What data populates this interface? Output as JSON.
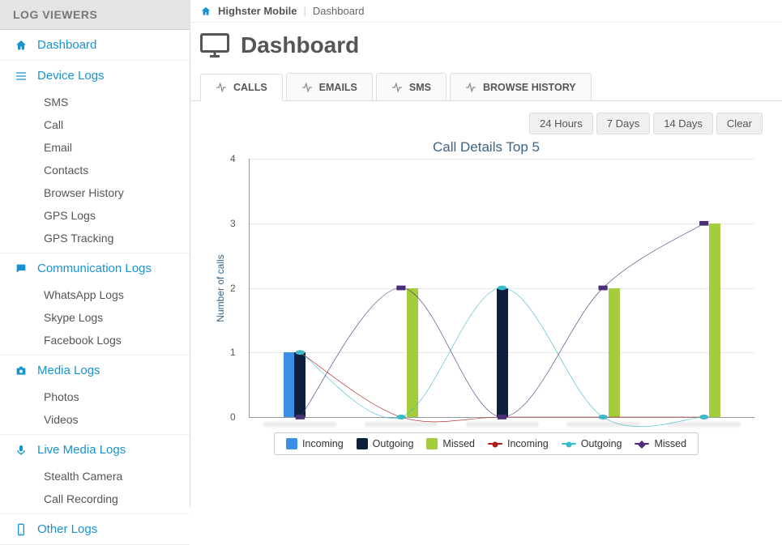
{
  "sidebar": {
    "header": "LOG VIEWERS",
    "groups": [
      {
        "icon": "home-icon",
        "label": "Dashboard",
        "items": []
      },
      {
        "icon": "list-icon",
        "label": "Device Logs",
        "items": [
          "SMS",
          "Call",
          "Email",
          "Contacts",
          "Browser History",
          "GPS Logs",
          "GPS Tracking"
        ]
      },
      {
        "icon": "chat-icon",
        "label": "Communication Logs",
        "items": [
          "WhatsApp Logs",
          "Skype Logs",
          "Facebook Logs"
        ]
      },
      {
        "icon": "camera-icon",
        "label": "Media Logs",
        "items": [
          "Photos",
          "Videos"
        ]
      },
      {
        "icon": "mic-icon",
        "label": "Live Media Logs",
        "items": [
          "Stealth Camera",
          "Call Recording"
        ]
      },
      {
        "icon": "phone-icon",
        "label": "Other Logs",
        "items": []
      }
    ]
  },
  "breadcrumb": {
    "app": "Highster Mobile",
    "page": "Dashboard"
  },
  "page": {
    "title": "Dashboard"
  },
  "tabs": [
    {
      "label": "CALLS",
      "active": true
    },
    {
      "label": "EMAILS",
      "active": false
    },
    {
      "label": "SMS",
      "active": false
    },
    {
      "label": "BROWSE HISTORY",
      "active": false
    }
  ],
  "controls": [
    "24 Hours",
    "7 Days",
    "14 Days",
    "Clear"
  ],
  "colors": {
    "incoming_bar": "#3b8ee6",
    "outgoing_bar": "#0e1e3d",
    "missed_bar": "#a3cd3b",
    "incoming_line": "#b01919",
    "outgoing_line": "#39bcc9",
    "missed_line": "#4a2e78",
    "accent": "#1893d1"
  },
  "chart_data": {
    "type": "bar",
    "title": "Call Details Top 5",
    "ylabel": "Number of calls",
    "xlabel": "",
    "ylim": [
      0,
      4
    ],
    "yticks": [
      0,
      1,
      2,
      3,
      4
    ],
    "categories": [
      "c1",
      "c2",
      "c3",
      "c4",
      "c5"
    ],
    "series": [
      {
        "name": "Incoming",
        "kind": "bar",
        "color_key": "incoming_bar",
        "values": [
          1,
          0,
          0,
          0,
          0
        ]
      },
      {
        "name": "Outgoing",
        "kind": "bar",
        "color_key": "outgoing_bar",
        "values": [
          1,
          0,
          2,
          0,
          0
        ]
      },
      {
        "name": "Missed",
        "kind": "bar",
        "color_key": "missed_bar",
        "values": [
          0,
          2,
          0,
          2,
          3
        ]
      },
      {
        "name": "Incoming",
        "kind": "line",
        "color_key": "incoming_line",
        "marker": "round",
        "values": [
          1,
          0,
          0,
          0,
          0
        ]
      },
      {
        "name": "Outgoing",
        "kind": "line",
        "color_key": "outgoing_line",
        "marker": "round",
        "values": [
          1,
          0,
          2,
          0,
          0
        ]
      },
      {
        "name": "Missed",
        "kind": "line",
        "color_key": "missed_line",
        "marker": "square",
        "values": [
          0,
          2,
          0,
          2,
          3
        ]
      }
    ]
  }
}
